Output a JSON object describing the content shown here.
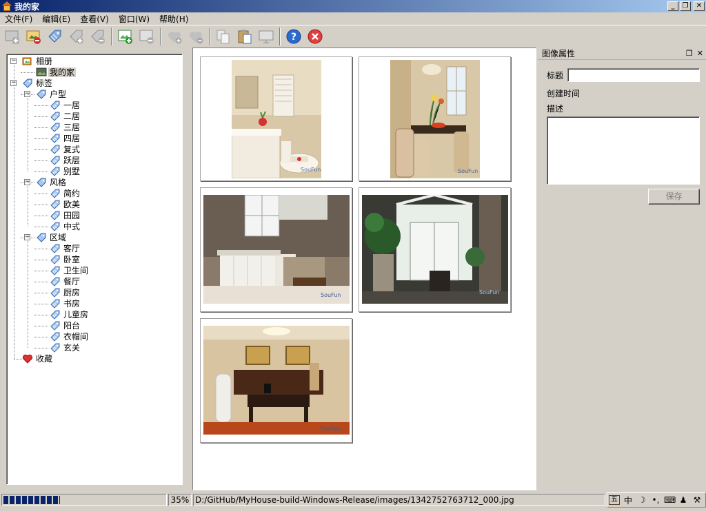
{
  "window": {
    "title": "我的家",
    "btn_minimize": "_",
    "btn_restore": "❐",
    "btn_close": "✕"
  },
  "menu": [
    "文件(F)",
    "编辑(E)",
    "查看(V)",
    "窗口(W)",
    "帮助(H)"
  ],
  "toolbar": {
    "buttons": [
      "add-photo-icon",
      "remove-photo-icon",
      "tag-icon",
      "add-tag-icon",
      "remove-tag-icon",
      "add-image-icon",
      "remove-image-icon",
      "add-favorite-icon",
      "remove-favorite-icon",
      "copy-icon",
      "paste-icon",
      "slideshow-icon",
      "help-icon",
      "close-icon"
    ]
  },
  "tree": {
    "albums": {
      "label": "相册",
      "children": [
        "我的家"
      ]
    },
    "tags": {
      "label": "标签",
      "groups": [
        {
          "label": "户型",
          "items": [
            "一居",
            "二居",
            "三居",
            "四居",
            "复式",
            "跃层",
            "别墅"
          ]
        },
        {
          "label": "风格",
          "items": [
            "简约",
            "欧美",
            "田园",
            "中式"
          ]
        },
        {
          "label": "区域",
          "items": [
            "客厅",
            "卧室",
            "卫生间",
            "餐厅",
            "厨房",
            "书房",
            "儿童房",
            "阳台",
            "衣帽间",
            "玄关"
          ]
        }
      ]
    },
    "favorites": "收藏"
  },
  "gallery": {
    "photos": [
      "bathroom",
      "dining-room",
      "kitchen",
      "sunroom",
      "study"
    ],
    "watermark": "SouFun"
  },
  "properties": {
    "heading": "图像属性",
    "float_icon": "❐",
    "close_icon": "✕",
    "title_label": "标题",
    "title_value": "",
    "created_label": "创建时间",
    "desc_label": "描述",
    "desc_value": "",
    "save_label": "保存"
  },
  "status": {
    "progress": 0.35,
    "percent": "35%",
    "path": "D:/GitHub/MyHouse-build-Windows-Release/images/1342752763712_000.jpg",
    "ime_mode": "中"
  }
}
